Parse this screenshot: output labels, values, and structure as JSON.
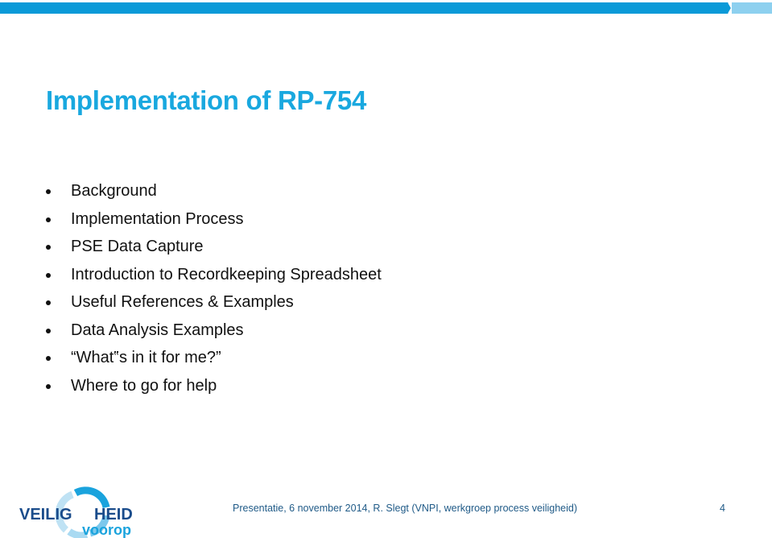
{
  "slide": {
    "title": "Implementation of RP-754",
    "bullets": [
      "Background",
      "Implementation Process",
      "PSE Data Capture",
      "Introduction to Recordkeeping Spreadsheet",
      "Useful References & Examples",
      "Data Analysis Examples",
      "“What‟s in it for me?”",
      "Where to go for help"
    ]
  },
  "footer": {
    "text": "Presentatie, 6 november 2014, R. Slegt (VNPI, werkgroep process veiligheid)",
    "page_number": "4"
  },
  "logo": {
    "word1": "VEILIG",
    "word2": "HEID",
    "word3": "voorop"
  },
  "colors": {
    "accent_blue": "#0a9ad8",
    "light_blue": "#8dd0ef",
    "title_blue": "#19a8df",
    "logo_navy": "#1a4c8b",
    "footer_blue": "#1f5a87"
  }
}
